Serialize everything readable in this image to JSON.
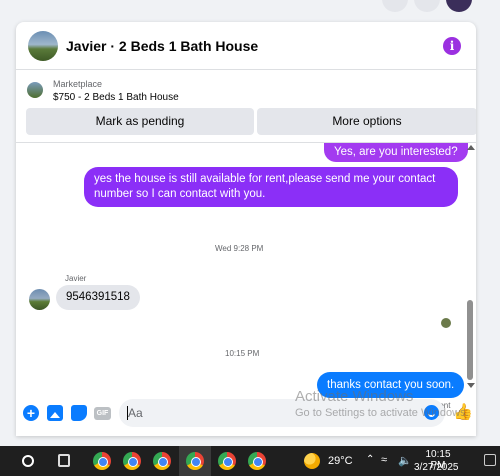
{
  "conversation": {
    "title": "Javier · 2 Beds 1 Bath House",
    "info_icon": "info-icon"
  },
  "marketplace": {
    "label": "Marketplace",
    "listing": "$750 - 2 Beds 1 Bath House",
    "mark_pending_label": "Mark as pending",
    "more_options_label": "More options"
  },
  "messages": [
    {
      "direction": "outgoing",
      "text": "Yes, are you interested?"
    },
    {
      "direction": "outgoing",
      "text": "yes the house is still available for rent,please send me your contact number so I can contact with you."
    },
    {
      "type": "timestamp",
      "text": "Wed 9:28 PM"
    },
    {
      "direction": "incoming",
      "sender": "Javier",
      "text": "9546391518"
    },
    {
      "type": "timestamp",
      "text": "10:15 PM"
    },
    {
      "direction": "outgoing",
      "text": "thanks contact you soon.",
      "status": "Sent"
    }
  ],
  "composer": {
    "placeholder": "Aa",
    "icons": [
      "plus-icon",
      "photo-icon",
      "sticker-icon",
      "gif-icon",
      "emoji-icon",
      "like-icon"
    ],
    "gif_label": "GIF"
  },
  "watermark": {
    "title": "Activate Windows",
    "subtitle": "Go to Settings to activate Windows."
  },
  "taskbar": {
    "temperature": "29°C",
    "time": "10:15 PM",
    "date": "3/27/2025"
  },
  "colors": {
    "outgoing_purple": "#8b2ff7",
    "outgoing_blue": "#0a7cff",
    "incoming_gray": "#e4e6eb",
    "info_purple": "#9b30e0"
  }
}
